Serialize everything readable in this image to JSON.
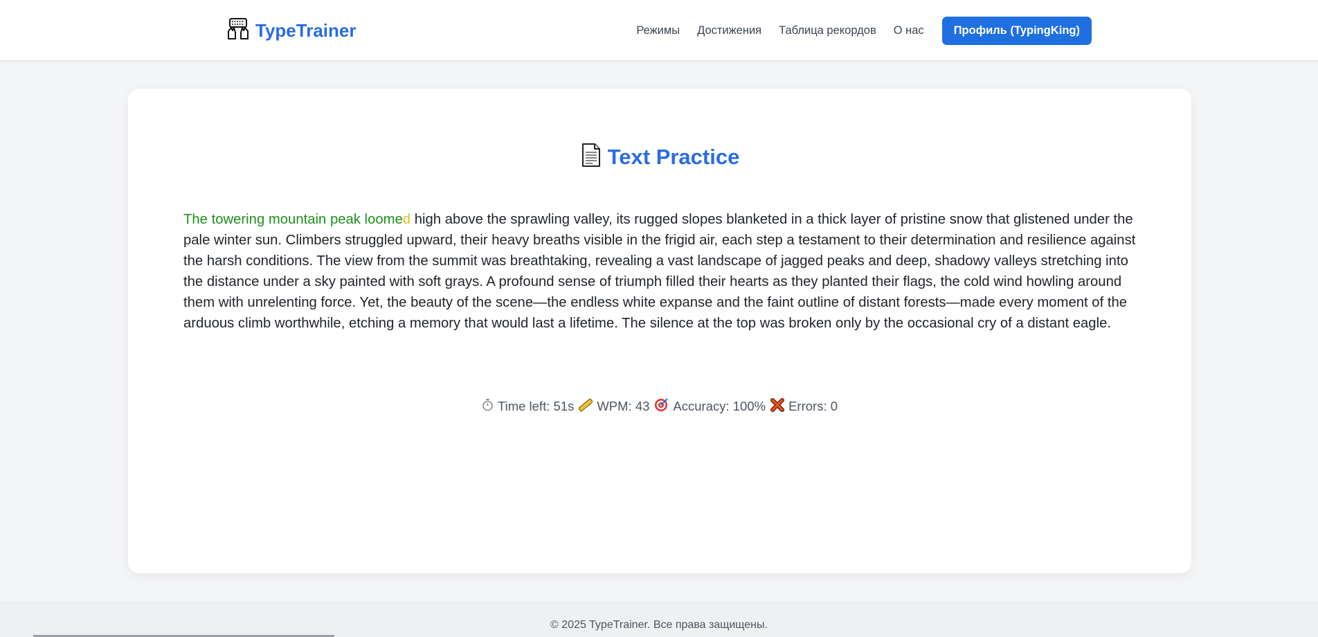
{
  "header": {
    "logo_text": "TypeTrainer",
    "logo_icon": "typing-hands-icon",
    "nav": [
      {
        "label": "Режимы"
      },
      {
        "label": "Достижения"
      },
      {
        "label": "Таблица рекордов"
      },
      {
        "label": "О нас"
      }
    ],
    "profile_label": "Профиль (TypingKing)"
  },
  "practice": {
    "title_icon": "document-icon",
    "title": "Text Practice",
    "text_typed": "The towering mountain peak loome",
    "text_current": "d",
    "text_remaining": " high above the sprawling valley, its rugged slopes blanketed in a thick layer of pristine snow that glistened under the pale winter sun. Climbers struggled upward, their heavy breaths visible in the frigid air, each step a testament to their determination and resilience against the harsh conditions. The view from the summit was breathtaking, revealing a vast landscape of jagged peaks and deep, shadowy valleys stretching into the distance under a sky painted with soft grays. A profound sense of triumph filled their hearts as they planted their flags, the cold wind howling around them with unrelenting force. Yet, the beauty of the scene—the endless white expanse and the faint outline of distant forests—made every moment of the arduous climb worthwhile, etching a memory that would last a lifetime. The silence at the top was broken only by the occasional cry of a distant eagle."
  },
  "stats": {
    "time": "Time left: 51s",
    "wpm": "WPM: 43",
    "accuracy": "Accuracy: 100%",
    "errors": "Errors: 0"
  },
  "footer": {
    "text": "© 2025 TypeTrainer. Все права защищены."
  },
  "colors": {
    "accent": "#2b6ce0",
    "button": "#1f6fe0",
    "typed_text": "#1f8f1f",
    "current_char": "#e2c020"
  }
}
